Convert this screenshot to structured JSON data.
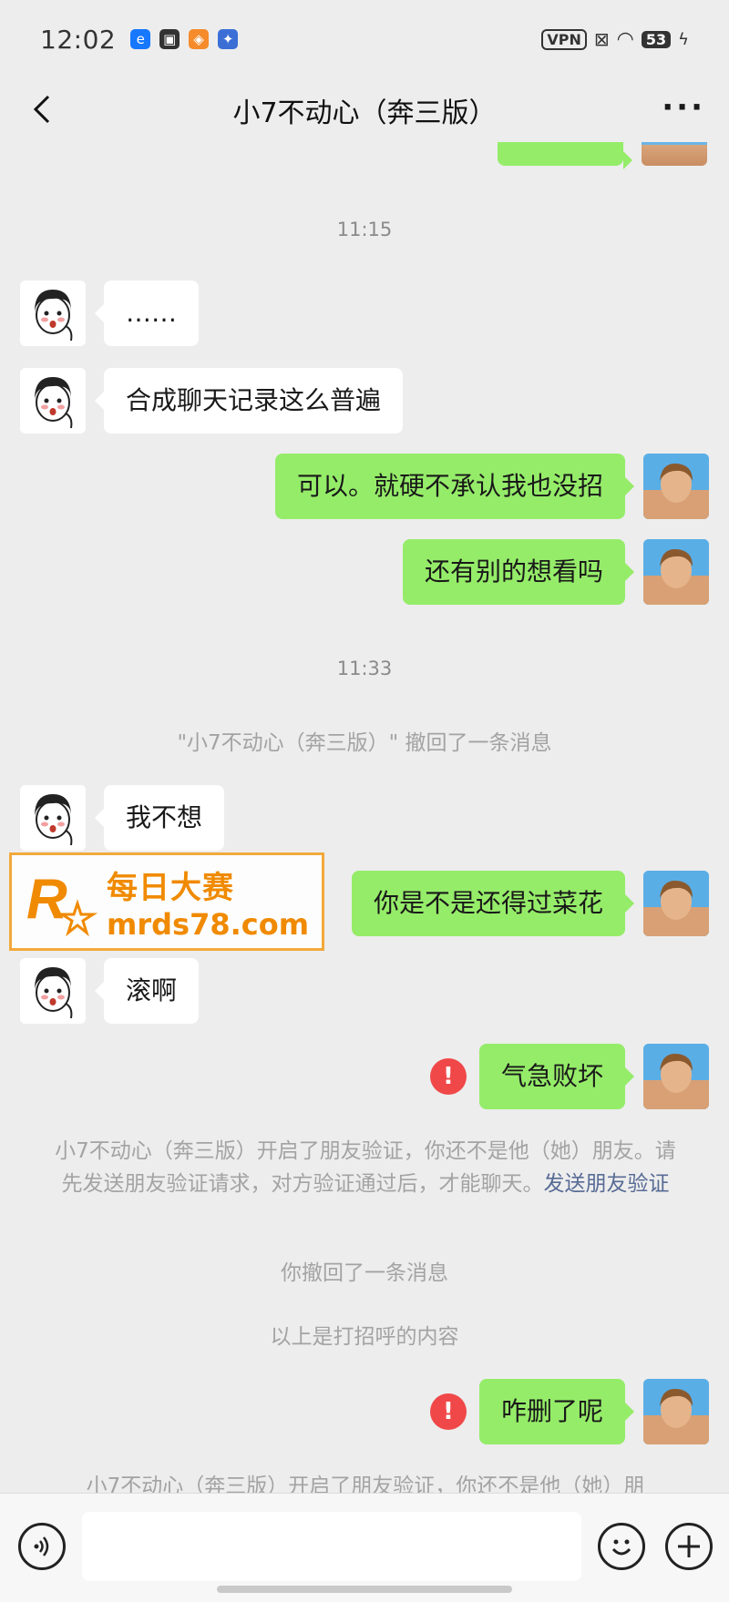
{
  "status_bar": {
    "time": "12:02",
    "battery": "53",
    "vpn": "VPN"
  },
  "header": {
    "title": "小7不动心（奔三版）"
  },
  "messages": {
    "time1": "11:15",
    "m1": "……",
    "m2": "合成聊天记录这么普遍",
    "m3": "可以。就硬不承认我也没招",
    "m4": "还有别的想看吗",
    "time2": "11:33",
    "recall1": "\"小7不动心（奔三版）\" 撤回了一条消息",
    "m5": "我不想",
    "m6": "你是不是还得过菜花",
    "m7": "滚啊",
    "m8": "气急败坏",
    "sys1_text": "小7不动心（奔三版）开启了朋友验证，你还不是他（她）朋友。请先发送朋友验证请求，对方验证通过后，才能聊天。",
    "sys1_link": "发送朋友验证",
    "recall2": "你撤回了一条消息",
    "greeting_note": "以上是打招呼的内容",
    "m9": "咋删了呢",
    "sys2_text": "小7不动心（奔三版）开启了朋友验证，你还不是他（她）朋"
  },
  "watermark": {
    "cn": "每日大赛",
    "url": "mrds78.com"
  },
  "colors": {
    "background": "#ededed",
    "outgoing_bubble": "#95ec69",
    "incoming_bubble": "#ffffff",
    "warning": "#f04848",
    "link": "#576b95",
    "watermark": "#f08a00"
  }
}
